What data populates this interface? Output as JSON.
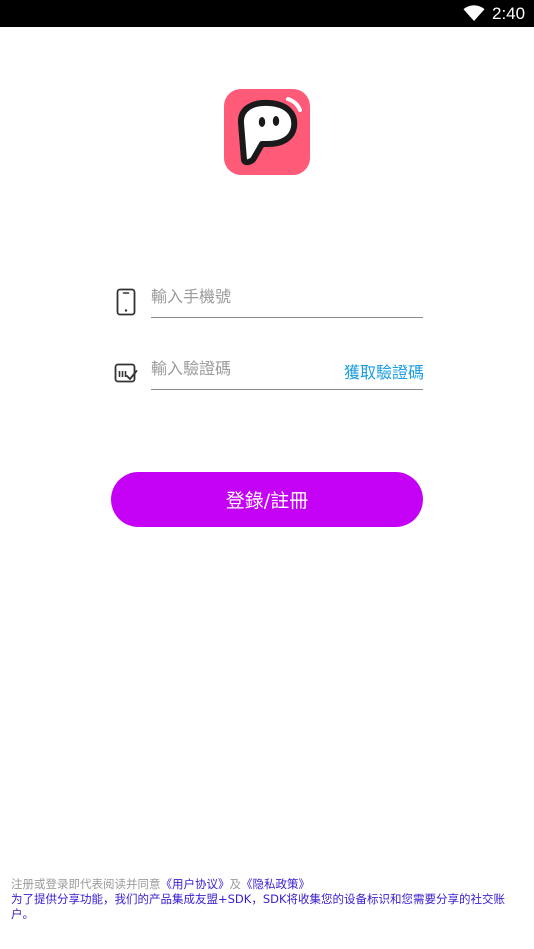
{
  "status_bar": {
    "time": "2:40",
    "wifi_icon": "wifi-icon"
  },
  "logo": {
    "icon": "app-logo-icon",
    "colors": {
      "background": "#ff5a78",
      "outline": "#1a1a1a",
      "face": "#ffffff"
    }
  },
  "login_form": {
    "phone": {
      "icon": "smartphone-icon",
      "placeholder": "輸入手機號",
      "value": ""
    },
    "code": {
      "icon": "verification-code-icon",
      "placeholder": "輸入驗證碼",
      "value": "",
      "get_code_label": "獲取驗證碼"
    },
    "submit_label": "登錄/註冊"
  },
  "footer": {
    "agreement_prefix": "注册或登录即代表阅读并同意",
    "user_agreement": "《用户协议》",
    "conjunction": "及",
    "privacy_policy": "《隐私政策》",
    "sdk_notice": "为了提供分享功能，我们的产品集成友盟+SDK，SDK将收集您的设备标识和您需要分享的社交账户。"
  },
  "colors": {
    "accent": "#c400f5",
    "link": "#1a9de0",
    "footer_link": "#3a1ccf"
  }
}
